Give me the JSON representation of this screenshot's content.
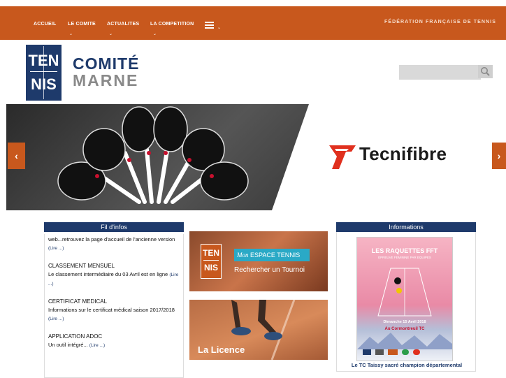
{
  "nav": {
    "items": [
      {
        "label": "ACCUEIL",
        "caret": ""
      },
      {
        "label": "LE COMITE",
        "caret": "⌄"
      },
      {
        "label": "ACTUALITES",
        "caret": "⌄"
      },
      {
        "label": "LA COMPETITION",
        "caret": "⌄"
      }
    ],
    "more_caret": "⌄",
    "federation": "FÉDÉRATION FRANÇAISE DE TENNIS",
    "bar_color": "#c8581d"
  },
  "logo": {
    "line1": "TEN",
    "line2": "NIS",
    "title": "COMITÉ",
    "subtitle": "MARNE",
    "color": "#1e3a6b"
  },
  "search": {
    "placeholder": "",
    "icon": "search-icon"
  },
  "banner": {
    "brand": "Tecnifibre",
    "prev_label": "‹",
    "next_label": "›"
  },
  "fil_infos": {
    "title": "Fil d'infos",
    "items": [
      {
        "title": "",
        "text": "web...retrouvez la page d'accueil de l'ancienne version",
        "lire": "(Lire ...)"
      },
      {
        "title": "CLASSEMENT MENSUEL",
        "text": "Le classement intermédiaire du 03 Avril est en ligne",
        "lire": "(Lire ...)"
      },
      {
        "title": "CERTIFICAT MEDICAL",
        "text": "Informations sur le certificat médical saison 2017/2018",
        "lire": "(Lire ...)"
      },
      {
        "title": "APPLICATION ADOC",
        "text": "Un outil intégré...",
        "lire": "(Lire ...)"
      }
    ]
  },
  "middle": {
    "espace": {
      "logo1": "TEN",
      "logo2": "NIS",
      "tag_italic": "Mon",
      "tag": "ESPACE TENNIS",
      "cta": "Rechercher un Tournoi"
    },
    "licence": {
      "label": "La Licence"
    }
  },
  "informations": {
    "title": "Informations",
    "poster": {
      "headline": "LES RAQUETTES FFT",
      "sub": "EPREUVE FEMININE PAR EQUIPES",
      "date": "Dimanche 15 Avril 2018",
      "place": "Au Cormontreuil TC"
    },
    "caption": "Le TC Taissy sacré champion départemental"
  },
  "colors": {
    "accent": "#c8581d",
    "navy": "#1e3a6b"
  }
}
